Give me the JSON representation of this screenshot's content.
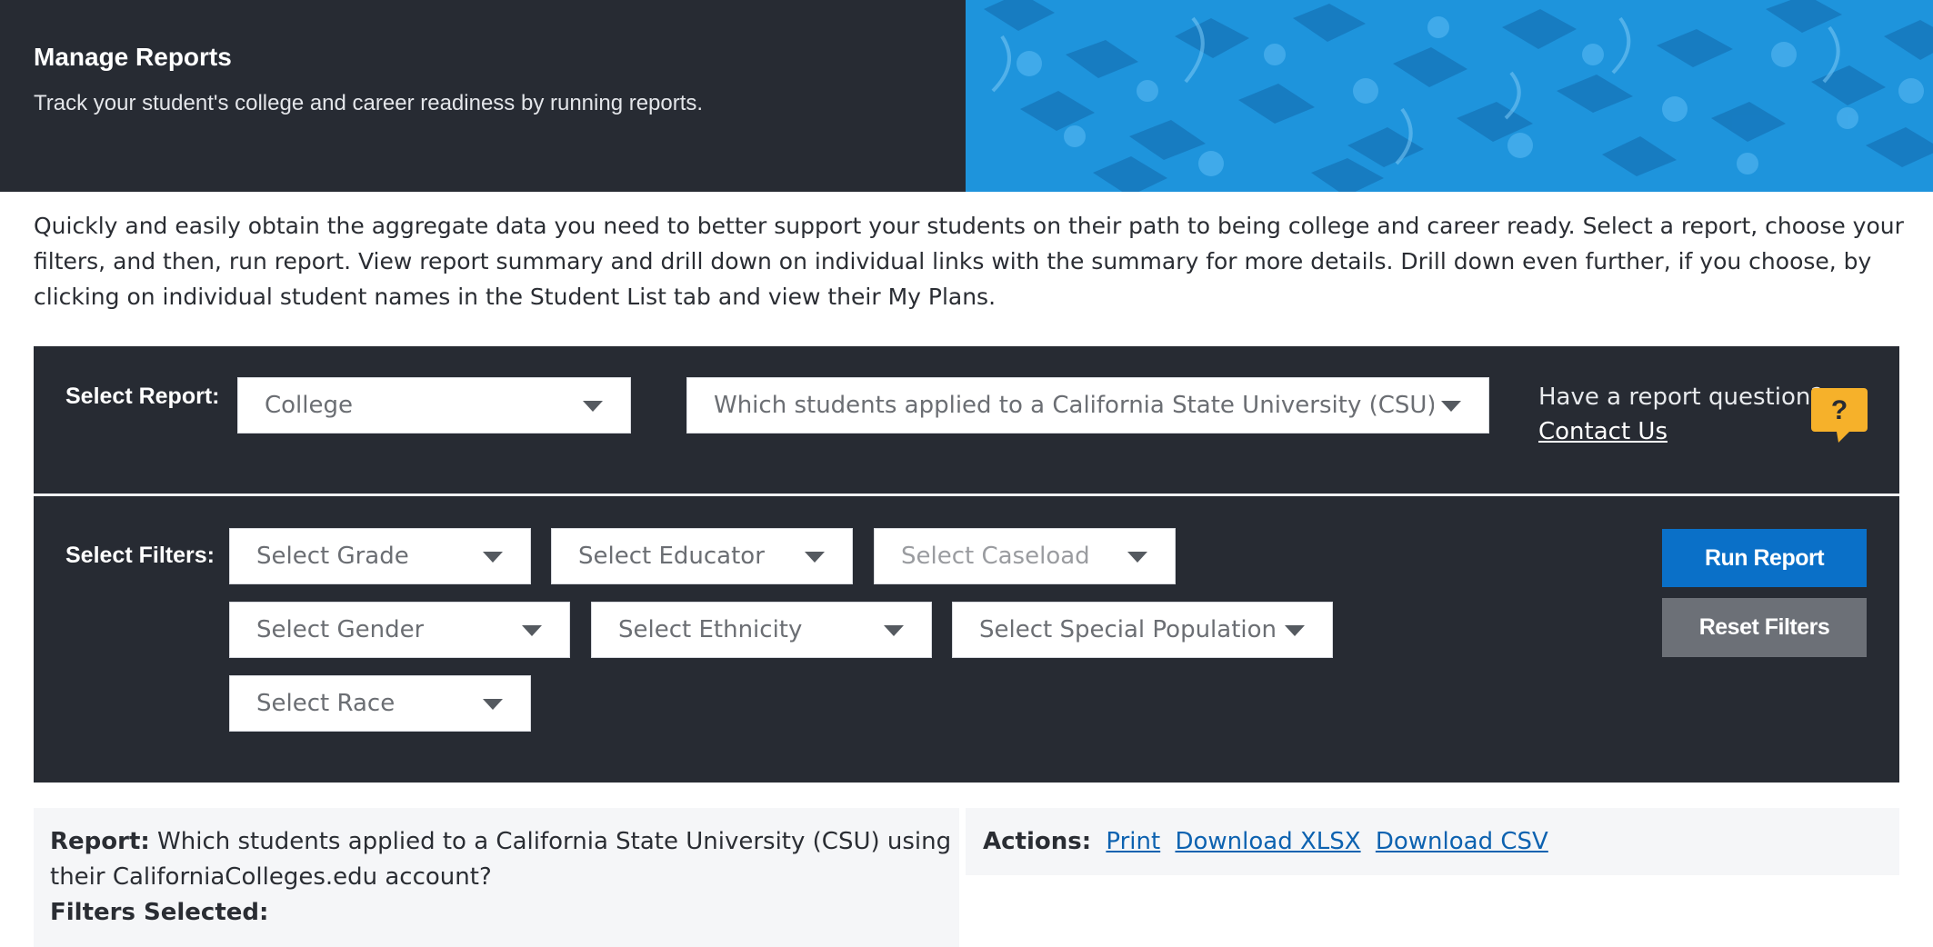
{
  "header": {
    "title": "Manage Reports",
    "subtitle": "Track your student's college and career readiness by running reports."
  },
  "intro": "Quickly and easily obtain the aggregate data you need to better support your students on their path to being college and career ready. Select a report, choose your filters, and then, run report. View report summary and drill down on individual links with the summary for more details. Drill down even further, if you choose, by clicking on individual student names in the Student List tab and view their My Plans.",
  "report_panel": {
    "label": "Select Report:",
    "category_value": "College",
    "report_value": "Which students applied to a California State University (CSU) using their CaliforniaColleges.edu account?",
    "question_text": "Have a report question?",
    "contact_link": "Contact Us",
    "help_icon_glyph": "?"
  },
  "filters_panel": {
    "label": "Select Filters:",
    "filters": [
      "Select Grade",
      "Select Educator",
      "Select Caseload",
      "Select Gender",
      "Select Ethnicity",
      "Select Special Population",
      "Select Race"
    ],
    "run_button": "Run Report",
    "reset_button": "Reset Filters"
  },
  "summary": {
    "report_label": "Report:",
    "report_text": "Which students applied to a California State University (CSU) using their CaliforniaColleges.edu account?",
    "filters_label": "Filters Selected:",
    "actions_label": "Actions:",
    "actions": [
      "Print",
      "Download XLSX",
      "Download CSV"
    ]
  },
  "colors": {
    "dark_panel": "#272b33",
    "hero_blue": "#1e94dc",
    "run_button": "#0a70c8",
    "reset_button": "#6c7077",
    "help_bubble": "#f6b12a",
    "link": "#0d62b0"
  }
}
